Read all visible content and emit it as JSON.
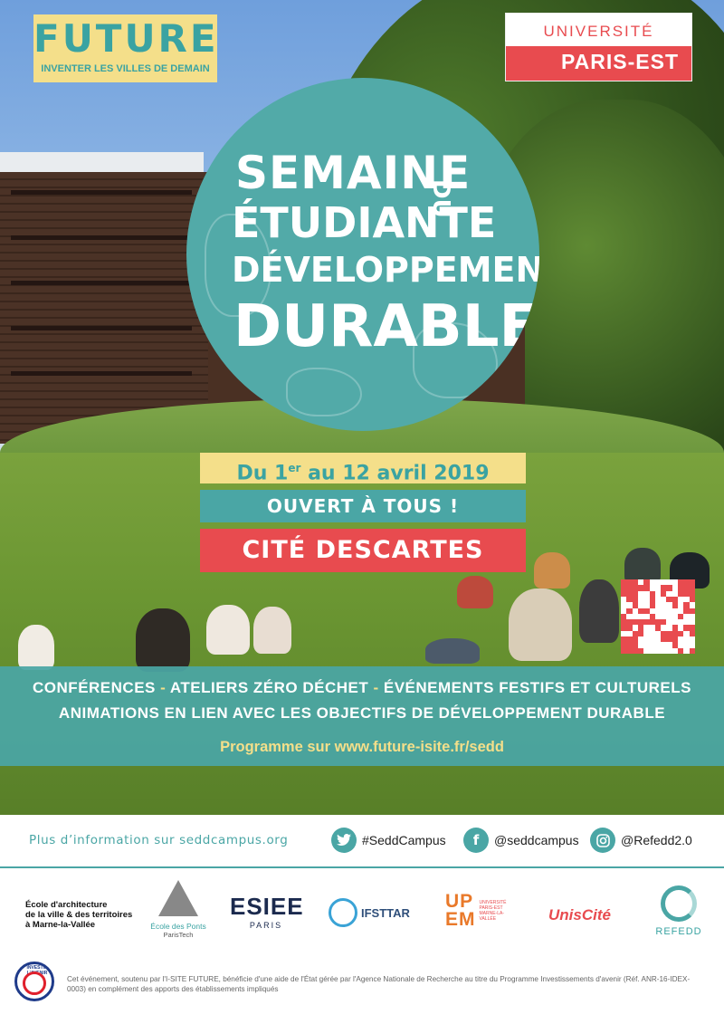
{
  "colors": {
    "teal": "#4aa6a5",
    "yellow": "#f4df8a",
    "red": "#e84b4f",
    "white": "#ffffff"
  },
  "logos": {
    "future": {
      "word": "FUTURE",
      "tagline": "INVENTER LES VILLES DE DEMAIN"
    },
    "upe": {
      "top": "UNIVERSITÉ",
      "bottom": "PARIS-EST"
    }
  },
  "title": {
    "line1": "SEMAINE",
    "line2": "ÉTUDIANTE",
    "line2_side": "DU",
    "line3": "DÉVELOPPEMENT",
    "line4": "DURABLE"
  },
  "event": {
    "date_prefix": "Du 1",
    "date_sup": "er",
    "date_suffix": " au 12 avril 2019",
    "open": "OUVERT À TOUS !",
    "location": "CITÉ DESCARTES"
  },
  "info": {
    "line1_parts": [
      "CONFÉRENCES",
      "ATELIERS ZÉRO DÉCHET",
      "ÉVÉNEMENTS FESTIFS ET CULTURELS"
    ],
    "separator": " - ",
    "line2": "ANIMATIONS EN LIEN AVEC LES OBJECTIFS DE DÉVELOPPEMENT DURABLE",
    "program": "Programme sur www.future-isite.fr/sedd"
  },
  "social": {
    "more_info": "Plus d’information sur seddcampus.org",
    "items": [
      {
        "icon": "twitter-icon",
        "label": "#SeddCampus"
      },
      {
        "icon": "facebook-icon",
        "label": "@seddcampus"
      },
      {
        "icon": "instagram-icon",
        "label": "@Refedd2.0"
      }
    ]
  },
  "partners": {
    "archi": [
      "École d'architecture",
      "de la ville & des territoires",
      "à Marne-la-Vallée"
    ],
    "ponts_name": "École des Ponts",
    "ponts_sub": "ParisTech",
    "esiee": "ESIEE",
    "esiee_sub": "PARIS",
    "ifsttar": "IFSTTAR",
    "upem_top": "UP",
    "upem_bottom": "EM",
    "upem_sub": "UNIVERSITÉ PARIS-EST MARNE-LA-VALLÉE",
    "unis_cite": "UnisCité",
    "refedd": "REFEDD"
  },
  "footer": {
    "seal_text": "INVESTIR L'AVENIR",
    "text": "Cet événement, soutenu par l'I-SITE FUTURE, bénéficie d'une aide de l'État gérée par l'Agence Nationale de Recherche au titre du Programme Investissements d'avenir (Réf. ANR-16-IDEX-0003) en complément des apports des établissements impliqués"
  }
}
